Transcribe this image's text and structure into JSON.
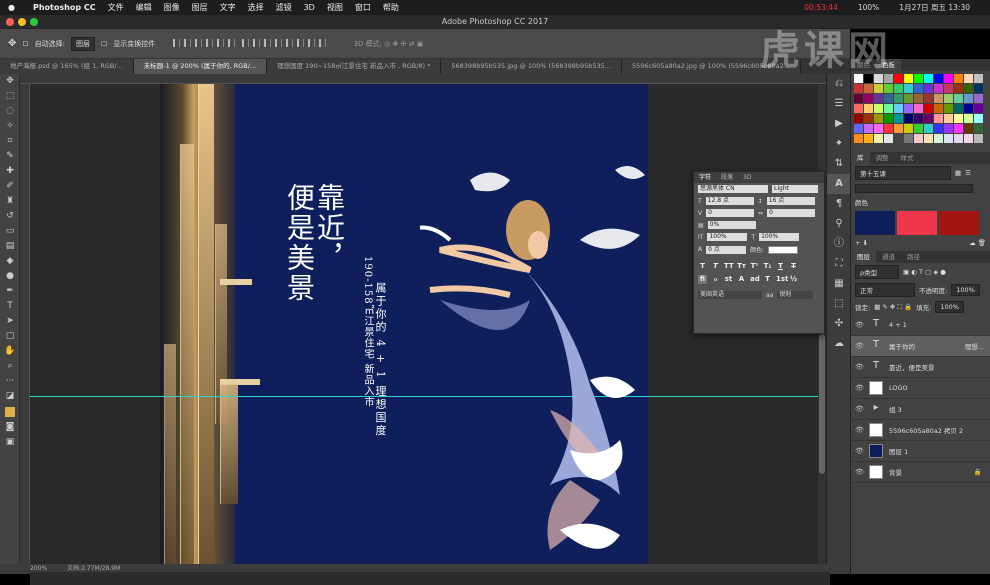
{
  "menubar": {
    "app": "Photoshop CC",
    "items": [
      "文件",
      "编辑",
      "图像",
      "图层",
      "文字",
      "选择",
      "滤镜",
      "3D",
      "视图",
      "窗口",
      "帮助"
    ],
    "time": "00:53:44",
    "battery": "100%",
    "date": "1月27日 周五 13:30"
  },
  "window": {
    "title": "Adobe Photoshop CC 2017"
  },
  "options": {
    "auto_select": "自动选择:",
    "auto_select_value": "图层",
    "show_transform": "显示变换控件"
  },
  "tabs": [
    {
      "label": "地产海报.psd @ 165% (组 1, RGB/...",
      "active": false
    },
    {
      "label": "未标题-1 @ 200% (属于你的, RGB/...",
      "active": true
    },
    {
      "label": "理想国度 190~158㎡江景住宅  新品入市 , RGB/8) *",
      "active": false
    },
    {
      "label": "568398b95b535.jpg @ 100% (568398b95b535...",
      "active": false
    },
    {
      "label": "5596c605a80a2.jpg @ 100% (5596c605a80a2...",
      "active": false
    }
  ],
  "poster": {
    "headline": [
      "靠近，",
      "便是美景"
    ],
    "sub1": "属于你的  4 + 1  理想国度",
    "sub2": "190-158㎡江景住宅  新品入市"
  },
  "status": {
    "zoom": "200%",
    "doc": "文档:2.77M/28.9M"
  },
  "charpanel": {
    "tabs": [
      "字符",
      "段落",
      "3D"
    ],
    "font": "思源黑体 CN",
    "style": "Light",
    "size": "12.8 点",
    "leading": "16 点",
    "kerning": "0",
    "tracking": "0",
    "scale_h": "0%",
    "vscale": "100%",
    "hscale": "100%",
    "baseline": "0 点",
    "color_label": "颜色:",
    "lang": "美国英语",
    "aa": "锐利"
  },
  "color_panel": {
    "tabs": [
      "颜色",
      "色板"
    ]
  },
  "library": {
    "tabs": [
      "库",
      "调整",
      "样式"
    ],
    "name": "第十五课",
    "section": "颜色",
    "colors": [
      "#0d1f5b",
      "#f0364b",
      "#a31510"
    ]
  },
  "layers_panel": {
    "tabs": [
      "图层",
      "通道",
      "路径"
    ],
    "kind": "ρ类型",
    "blend": "正常",
    "opacity_label": "不透明度:",
    "opacity": "100%",
    "lock_label": "锁定:",
    "fill_label": "填充:",
    "fill": "100%"
  },
  "layers": [
    {
      "name": "4 + 1",
      "kind": "T",
      "selected": false
    },
    {
      "name": "属于你的",
      "kind": "T",
      "selected": true,
      "extra": "理想..."
    },
    {
      "name": "靠近，便是美景",
      "kind": "T",
      "selected": false
    },
    {
      "name": "LOGO",
      "kind": "img",
      "selected": false
    },
    {
      "name": "组 3",
      "kind": "group",
      "selected": false
    },
    {
      "name": "5596c605a80a2 拷贝 2",
      "kind": "img",
      "selected": false
    },
    {
      "name": "图层 1",
      "kind": "fill",
      "selected": false
    },
    {
      "name": "背景",
      "kind": "bg",
      "selected": false
    }
  ],
  "watermark": "虎课网"
}
